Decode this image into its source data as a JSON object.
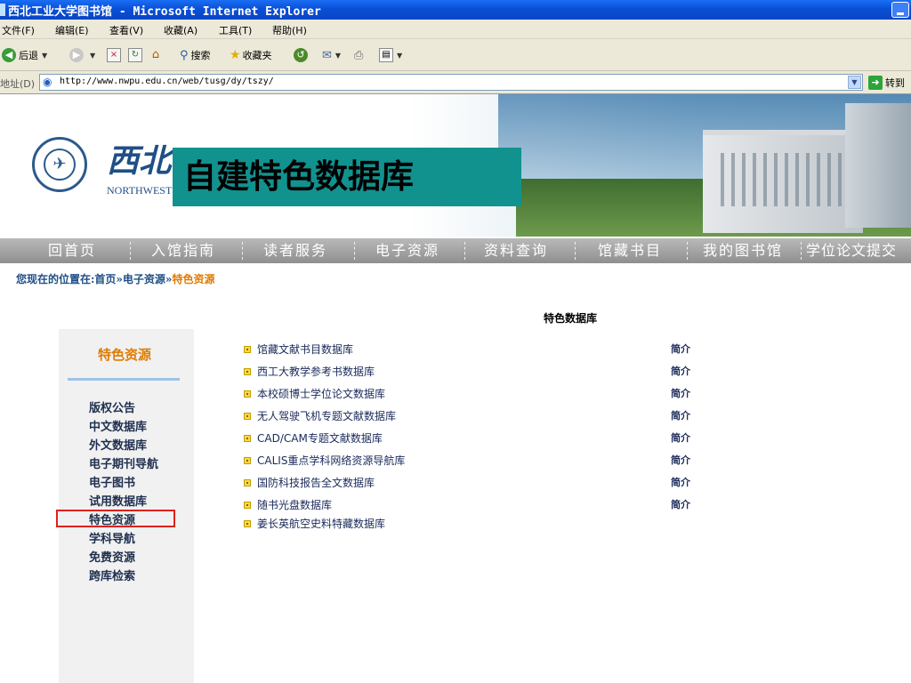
{
  "window": {
    "title": "西北工业大学图书馆 - Microsoft Internet Explorer"
  },
  "menu": [
    "文件(F)",
    "编辑(E)",
    "查看(V)",
    "收藏(A)",
    "工具(T)",
    "帮助(H)"
  ],
  "toolbar": {
    "back": "后退",
    "search": "搜索",
    "favorites": "收藏夹"
  },
  "address": {
    "label": "地址(D)",
    "url": "http://www.nwpu.edu.cn/web/tusg/dy/tszy/",
    "go": "转到"
  },
  "banner": {
    "logo_cn": "西北",
    "logo_en": "NORTHWEST",
    "overlay_text": "自建特色数据库"
  },
  "nav": [
    "回首页",
    "入馆指南",
    "读者服务",
    "电子资源",
    "资料查询",
    "馆藏书目",
    "我的图书馆",
    "学位论文提交"
  ],
  "breadcrumb": {
    "prefix": "您现在的位置在:首页»电子资源»",
    "current": "特色资源"
  },
  "sidebar": {
    "title": "特色资源",
    "items": [
      "版权公告",
      "中文数据库",
      "外文数据库",
      "电子期刊导航",
      "电子图书",
      "试用数据库",
      "特色资源",
      "学科导航",
      "免费资源",
      "跨库检索"
    ]
  },
  "main": {
    "heading": "特色数据库",
    "databases": [
      {
        "name": "馆藏文献书目数据库",
        "intro": "简介"
      },
      {
        "name": "西工大教学参考书数据库",
        "intro": "简介"
      },
      {
        "name": "本校硕博士学位论文数据库",
        "intro": "简介"
      },
      {
        "name": "无人驾驶飞机专题文献数据库",
        "intro": "简介"
      },
      {
        "name": "CAD/CAM专题文献数据库",
        "intro": "简介"
      },
      {
        "name": "CALIS重点学科网络资源导航库",
        "intro": "简介"
      },
      {
        "name": "国防科技报告全文数据库",
        "intro": "简介"
      },
      {
        "name": "随书光盘数据库",
        "intro": "简介"
      },
      {
        "name": "姜长英航空史料特藏数据库",
        "intro": ""
      }
    ]
  }
}
